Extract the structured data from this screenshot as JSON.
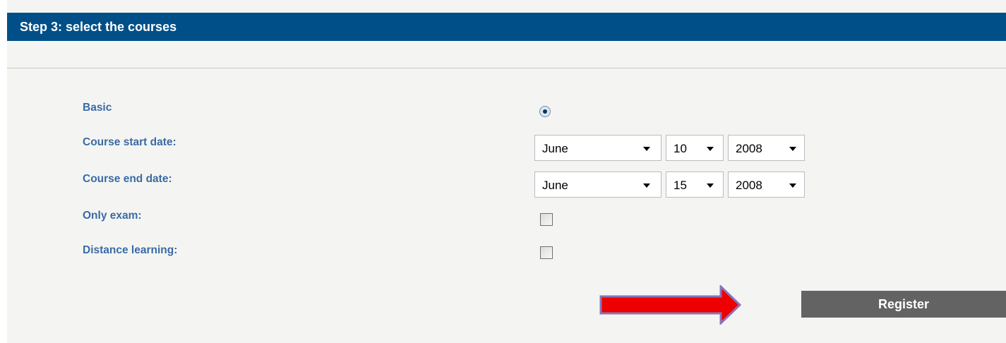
{
  "header": {
    "title": "Step 3: select the courses"
  },
  "form": {
    "basic_label": "Basic",
    "basic_selected": true,
    "start_label": "Course start date:",
    "end_label": "Course end date:",
    "only_exam_label": "Only exam:",
    "only_exam_checked": false,
    "distance_label": "Distance learning:",
    "distance_checked": false,
    "start_date": {
      "month": "June",
      "day": "10",
      "year": "2008"
    },
    "end_date": {
      "month": "June",
      "day": "15",
      "year": "2008"
    }
  },
  "register_button": {
    "label": "Register"
  },
  "annotation": {
    "arrow_color": "#ee0000",
    "arrow_outline": "#8b73b8"
  },
  "colors": {
    "header_bg": "#004f88",
    "label": "#3a6aa6",
    "button_bg": "#636363"
  }
}
